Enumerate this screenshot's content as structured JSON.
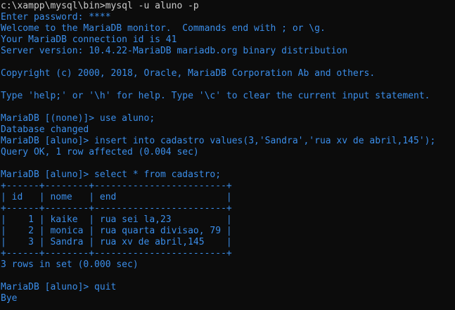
{
  "terminal": {
    "lines": [
      "c:\\xampp\\mysql\\bin>mysql -u aluno -p",
      "Enter password: ****",
      "Welcome to the MariaDB monitor.  Commands end with ; or \\g.",
      "Your MariaDB connection id is 41",
      "Server version: 10.4.22-MariaDB mariadb.org binary distribution",
      "",
      "Copyright (c) 2000, 2018, Oracle, MariaDB Corporation Ab and others.",
      "",
      "Type 'help;' or '\\h' for help. Type '\\c' to clear the current input statement.",
      "",
      "MariaDB [(none)]> use aluno;",
      "Database changed",
      "MariaDB [aluno]> insert into cadastro values(3,'Sandra','rua xv de abril,145');",
      "Query OK, 1 row affected (0.004 sec)",
      "",
      "MariaDB [aluno]> select * from cadastro;",
      "+------+--------+------------------------+",
      "| id   | nome   | end                    |",
      "+------+--------+------------------------+",
      "|    1 | kaike  | rua sei la,23          |",
      "|    2 | monica | rua quarta divisao, 79 |",
      "|    3 | Sandra | rua xv de abril,145    |",
      "+------+--------+------------------------+",
      "3 rows in set (0.000 sec)",
      "",
      "MariaDB [aluno]> quit",
      "Bye"
    ]
  },
  "colors": {
    "background": "#0c0c0c",
    "text_white": "#cccccc",
    "text_blue": "#3b8eea"
  }
}
